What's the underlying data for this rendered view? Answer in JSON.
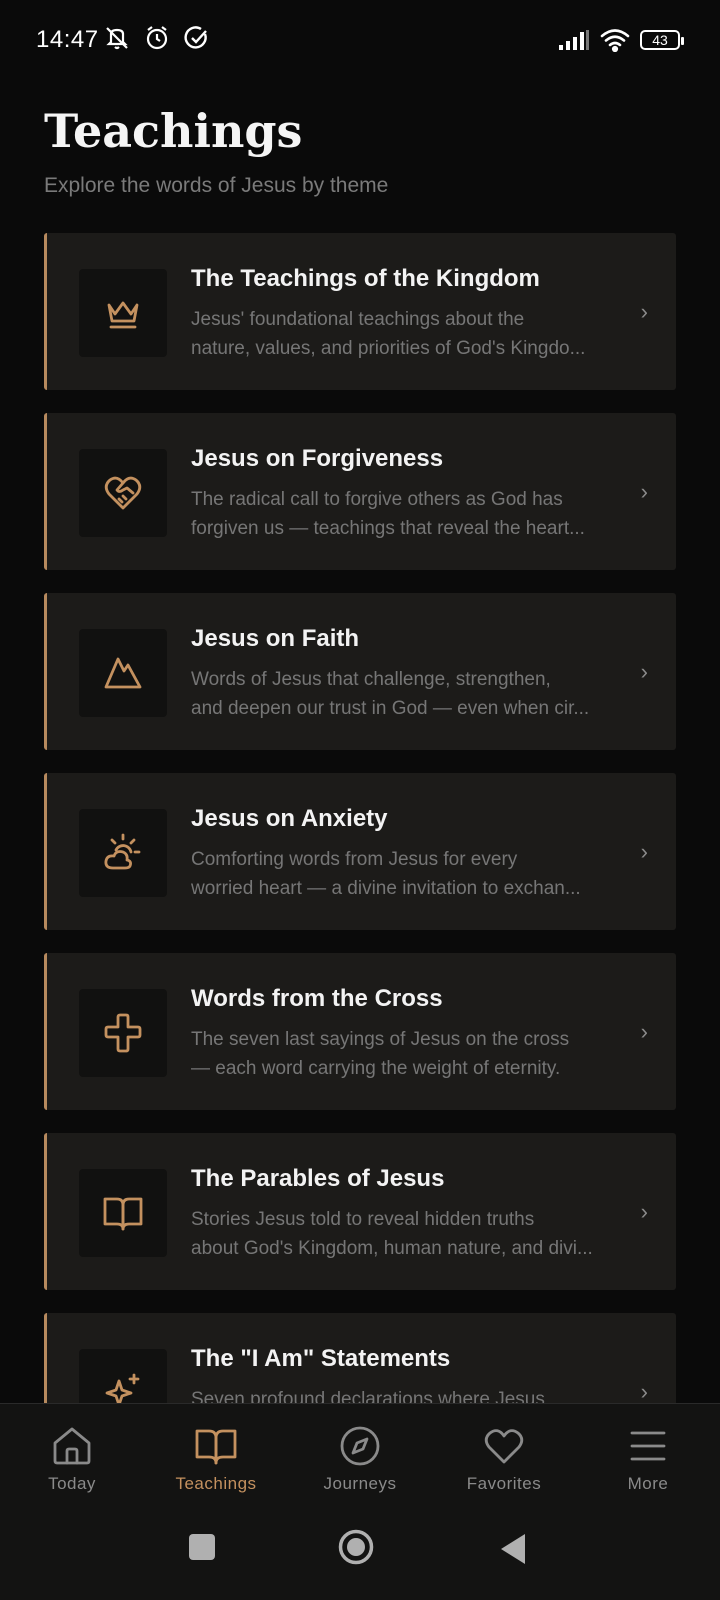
{
  "status_bar": {
    "time": "14:47",
    "battery": "43"
  },
  "header": {
    "title": "Teachings",
    "subtitle": "Explore the words of Jesus by theme"
  },
  "teachings": [
    {
      "title": "The Teachings of the Kingdom",
      "desc_line1": "Jesus' foundational teachings about the",
      "desc_line2": "nature, values, and priorities of God's Kingdo...",
      "icon": "crown-icon"
    },
    {
      "title": "Jesus on Forgiveness",
      "desc_line1": "The radical call to forgive others as God has",
      "desc_line2": "forgiven us — teachings that reveal the heart...",
      "icon": "heart-handshake-icon"
    },
    {
      "title": "Jesus on Faith",
      "desc_line1": "Words of Jesus that challenge, strengthen,",
      "desc_line2": "and deepen our trust in God — even when cir...",
      "icon": "mountain-icon"
    },
    {
      "title": "Jesus on Anxiety",
      "desc_line1": "Comforting words from Jesus for every",
      "desc_line2": "worried heart — a divine invitation to exchan...",
      "icon": "sun-cloud-icon"
    },
    {
      "title": "Words from the Cross",
      "desc_line1": "The seven last sayings of Jesus on the cross",
      "desc_line2": "— each word carrying the weight of eternity.",
      "icon": "cross-icon"
    },
    {
      "title": "The Parables of Jesus",
      "desc_line1": "Stories Jesus told to reveal hidden truths",
      "desc_line2": "about God's Kingdom, human nature, and divi...",
      "icon": "open-book-icon"
    },
    {
      "title": "The \"I Am\" Statements",
      "desc_line1": "Seven profound declarations where Jesus",
      "desc_line2": "",
      "icon": "sparkle-icon"
    }
  ],
  "nav": {
    "today": "Today",
    "teachings": "Teachings",
    "journeys": "Journeys",
    "favorites": "Favorites",
    "more": "More"
  },
  "colors": {
    "accent": "#c4915f",
    "background": "#0a0a0a",
    "card": "#1c1b19"
  }
}
